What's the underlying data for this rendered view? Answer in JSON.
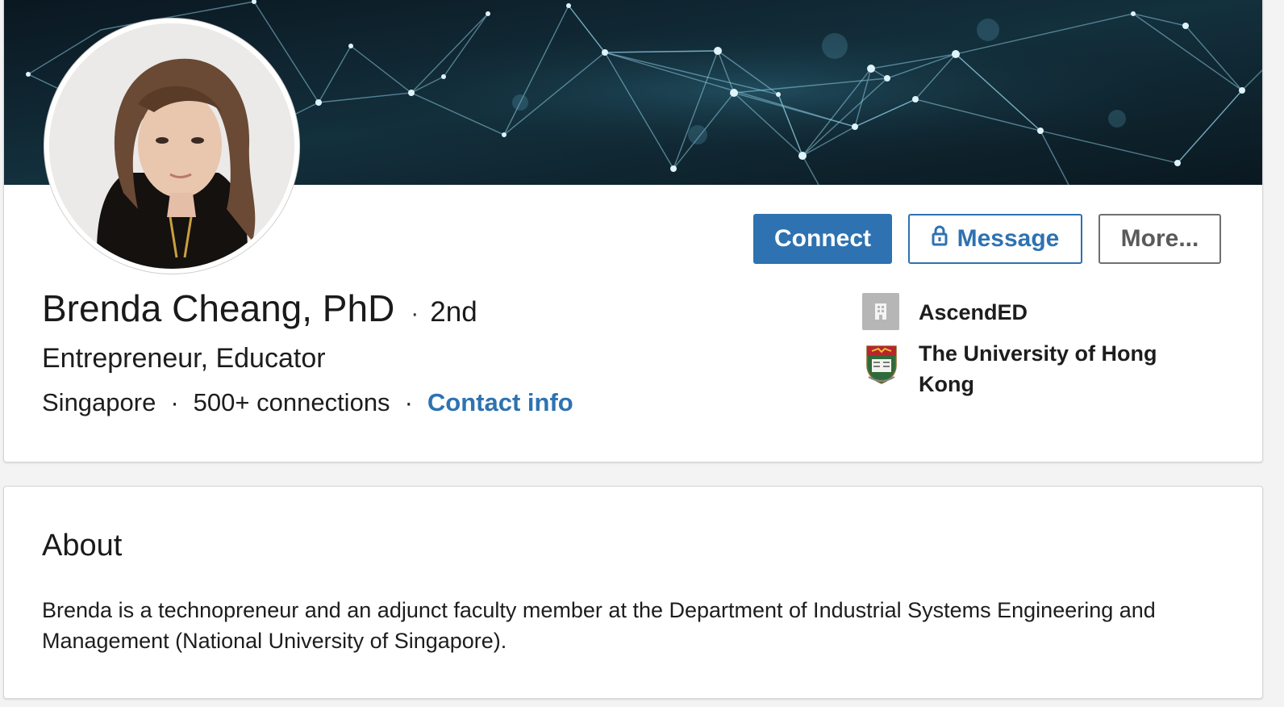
{
  "profile": {
    "name": "Brenda Cheang, PhD",
    "degree_separator": "·",
    "degree": "2nd",
    "headline": "Entrepreneur, Educator",
    "location": "Singapore",
    "connections": "500+ connections",
    "contact_info": "Contact info",
    "meta_separator": "·"
  },
  "actions": {
    "connect": "Connect",
    "message": "Message",
    "more": "More..."
  },
  "experience": {
    "company": {
      "name": "AscendED",
      "icon": "building-icon"
    },
    "education": {
      "name": "The University of Hong Kong",
      "icon": "university-crest-icon"
    }
  },
  "about": {
    "title": "About",
    "text": "Brenda is a technopreneur and an adjunct faculty member at the Department of Industrial Systems Engineering and Management (National University of Singapore)."
  },
  "colors": {
    "accent": "#2e72b1",
    "banner_dark": "#0b1a24",
    "banner_network": "#7ec2d8",
    "company_icon_bg": "#b6b6b6"
  }
}
